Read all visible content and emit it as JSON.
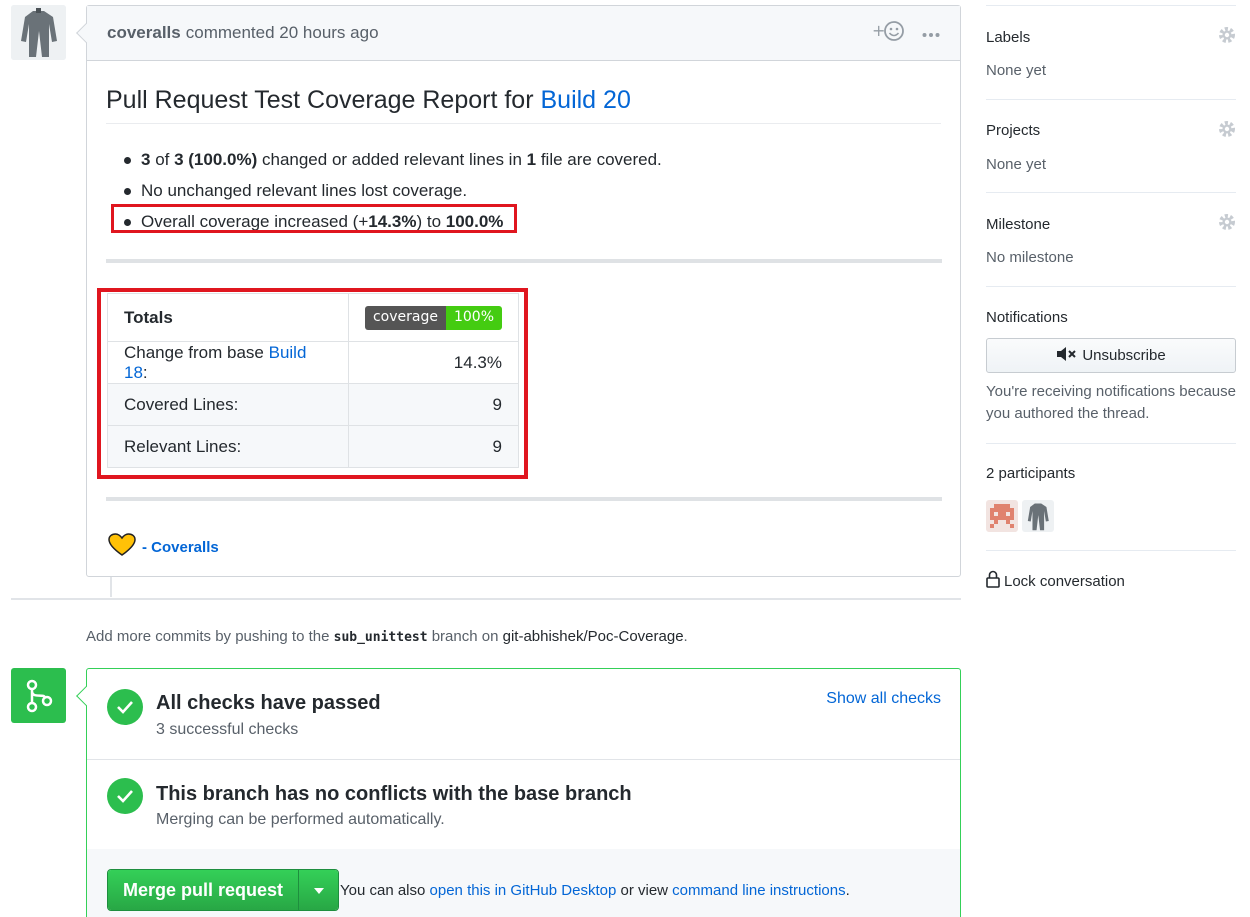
{
  "comment": {
    "author": "coveralls",
    "time": "commented 20 hours ago",
    "report_title_prefix": "Pull Request Test Coverage Report for",
    "report_title_link": "Build 20",
    "bullets": {
      "b1_a": "3",
      "b1_b": " of ",
      "b1_c": "3 (100.0%)",
      "b1_d": " changed or added relevant lines in ",
      "b1_e": "1",
      "b1_f": " file are covered.",
      "b2": "No unchanged relevant lines lost coverage.",
      "b3_a": "Overall coverage increased (+",
      "b3_b": "14.3%",
      "b3_c": ") to ",
      "b3_d": "100.0%"
    },
    "table": {
      "totals_label": "Totals",
      "badge_left": "coverage",
      "badge_right": "100%",
      "change_label_prefix": "Change from base",
      "change_link": "Build 18",
      "change_suffix": ":",
      "change_value": "14.3%",
      "covered_label": "Covered Lines:",
      "covered_value": "9",
      "relevant_label": "Relevant Lines:",
      "relevant_value": "9"
    },
    "signature": "- Coveralls"
  },
  "push_note": {
    "prefix": "Add more commits by pushing to the ",
    "branch": "sub_unittest",
    "middle": " branch on ",
    "repo": "git-abhishek/Poc-Coverage",
    "suffix": "."
  },
  "merge": {
    "checks_title": "All checks have passed",
    "checks_sub": "3 successful checks",
    "show_all": "Show all checks",
    "conflicts_title": "This branch has no conflicts with the base branch",
    "conflicts_sub": "Merging can be performed automatically.",
    "merge_button": "Merge pull request",
    "note_prefix": "You can also ",
    "note_link1": "open this in GitHub Desktop",
    "note_middle": " or view ",
    "note_link2": "command line instructions",
    "note_suffix": "."
  },
  "sidebar": {
    "labels_head": "Labels",
    "labels_val": "None yet",
    "projects_head": "Projects",
    "projects_val": "None yet",
    "milestone_head": "Milestone",
    "milestone_val": "No milestone",
    "notifications_head": "Notifications",
    "unsubscribe": "Unsubscribe",
    "notif_text": "You're receiving notifications because you authored the thread.",
    "participants_head": "2 participants",
    "lock": "Lock conversation"
  },
  "colors": {
    "highlight": "#e0161f",
    "success": "#2cbe4e",
    "link": "#0366d6"
  }
}
